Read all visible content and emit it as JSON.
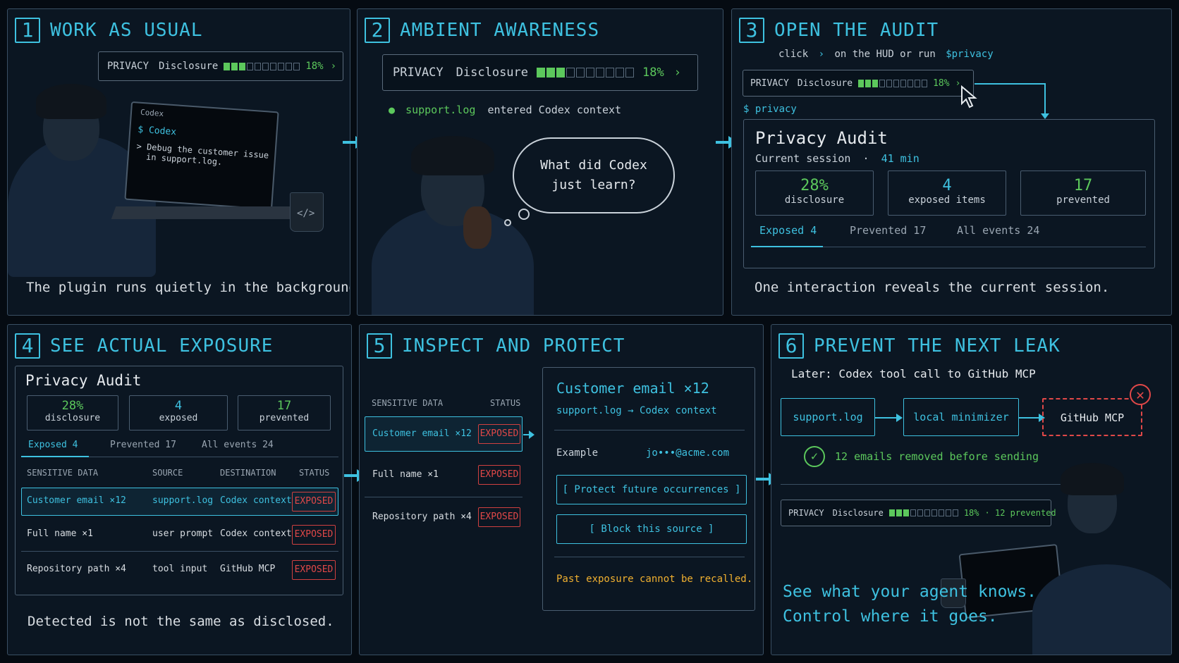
{
  "colors": {
    "accent": "#3ec1e0",
    "good": "#5cc85c",
    "danger": "#e04848",
    "warn": "#f0b030",
    "panel": "#0b1622"
  },
  "hud": {
    "label": "PRIVACY",
    "metric": "Disclosure",
    "percent": "18%",
    "chevron": "›",
    "progress_filled": 3,
    "progress_total": 10,
    "prevented": "· 12 prevented"
  },
  "p1": {
    "num": "1",
    "title": "WORK AS USUAL",
    "laptop_app": "Codex",
    "prompt_symbol": "$ Codex",
    "prompt_text": "> Debug the customer issue\n  in support.log.",
    "caption": "The plugin runs quietly in the background."
  },
  "p2": {
    "num": "2",
    "title": "AMBIENT AWARENESS",
    "event_file": "support.log",
    "event_text": "entered Codex context",
    "thought": "What did Codex\njust learn?"
  },
  "p3": {
    "num": "3",
    "title": "OPEN THE AUDIT",
    "hint_pre": "click",
    "hint_chevron": "›",
    "hint_mid": "on the HUD or run",
    "hint_cmd": "$privacy",
    "cmd_line": "$ privacy",
    "audit_title": "Privacy Audit",
    "session_label": "Current session",
    "session_sep": "·",
    "session_time": "41 min",
    "stats": [
      {
        "value": "28%",
        "label": "disclosure"
      },
      {
        "value": "4",
        "label": "exposed items"
      },
      {
        "value": "17",
        "label": "prevented"
      }
    ],
    "tabs": [
      "Exposed 4",
      "Prevented 17",
      "All events 24"
    ],
    "caption": "One interaction reveals the current session."
  },
  "p4": {
    "num": "4",
    "title": "SEE ACTUAL EXPOSURE",
    "audit_title": "Privacy Audit",
    "stats": [
      {
        "value": "28%",
        "label": "disclosure"
      },
      {
        "value": "4",
        "label": "exposed"
      },
      {
        "value": "17",
        "label": "prevented"
      }
    ],
    "tabs": [
      "Exposed 4",
      "Prevented 17",
      "All events 24"
    ],
    "columns": [
      "SENSITIVE DATA",
      "SOURCE",
      "DESTINATION",
      "STATUS"
    ],
    "rows": [
      {
        "data": "Customer email ×12",
        "source": "support.log",
        "dest": "Codex context",
        "status": "EXPOSED"
      },
      {
        "data": "Full name ×1",
        "source": "user prompt",
        "dest": "Codex context",
        "status": "EXPOSED"
      },
      {
        "data": "Repository path ×4",
        "source": "tool input",
        "dest": "GitHub MCP",
        "status": "EXPOSED"
      }
    ],
    "caption": "Detected is not the same as disclosed."
  },
  "p5": {
    "num": "5",
    "title": "INSPECT AND PROTECT",
    "columns": [
      "SENSITIVE DATA",
      "STATUS"
    ],
    "rows": [
      {
        "data": "Customer email ×12",
        "status": "EXPOSED"
      },
      {
        "data": "Full name ×1",
        "status": "EXPOSED"
      },
      {
        "data": "Repository path ×4",
        "status": "EXPOSED"
      }
    ],
    "detail_title": "Customer email ×12",
    "detail_flow": "support.log → Codex context",
    "example_label": "Example",
    "example_value": "jo•••@acme.com",
    "btn_protect": "[ Protect future occurrences ]",
    "btn_block": "[ Block this source ]",
    "warning": "Past exposure cannot be recalled."
  },
  "p6": {
    "num": "6",
    "title": "PREVENT THE NEXT LEAK",
    "subtitle": "Later: Codex tool call to GitHub MCP",
    "flow": [
      "support.log",
      "local minimizer",
      "GitHub MCP"
    ],
    "result": "12 emails removed before sending",
    "tagline_1": "See what your agent knows.",
    "tagline_2": "Control where it goes."
  }
}
